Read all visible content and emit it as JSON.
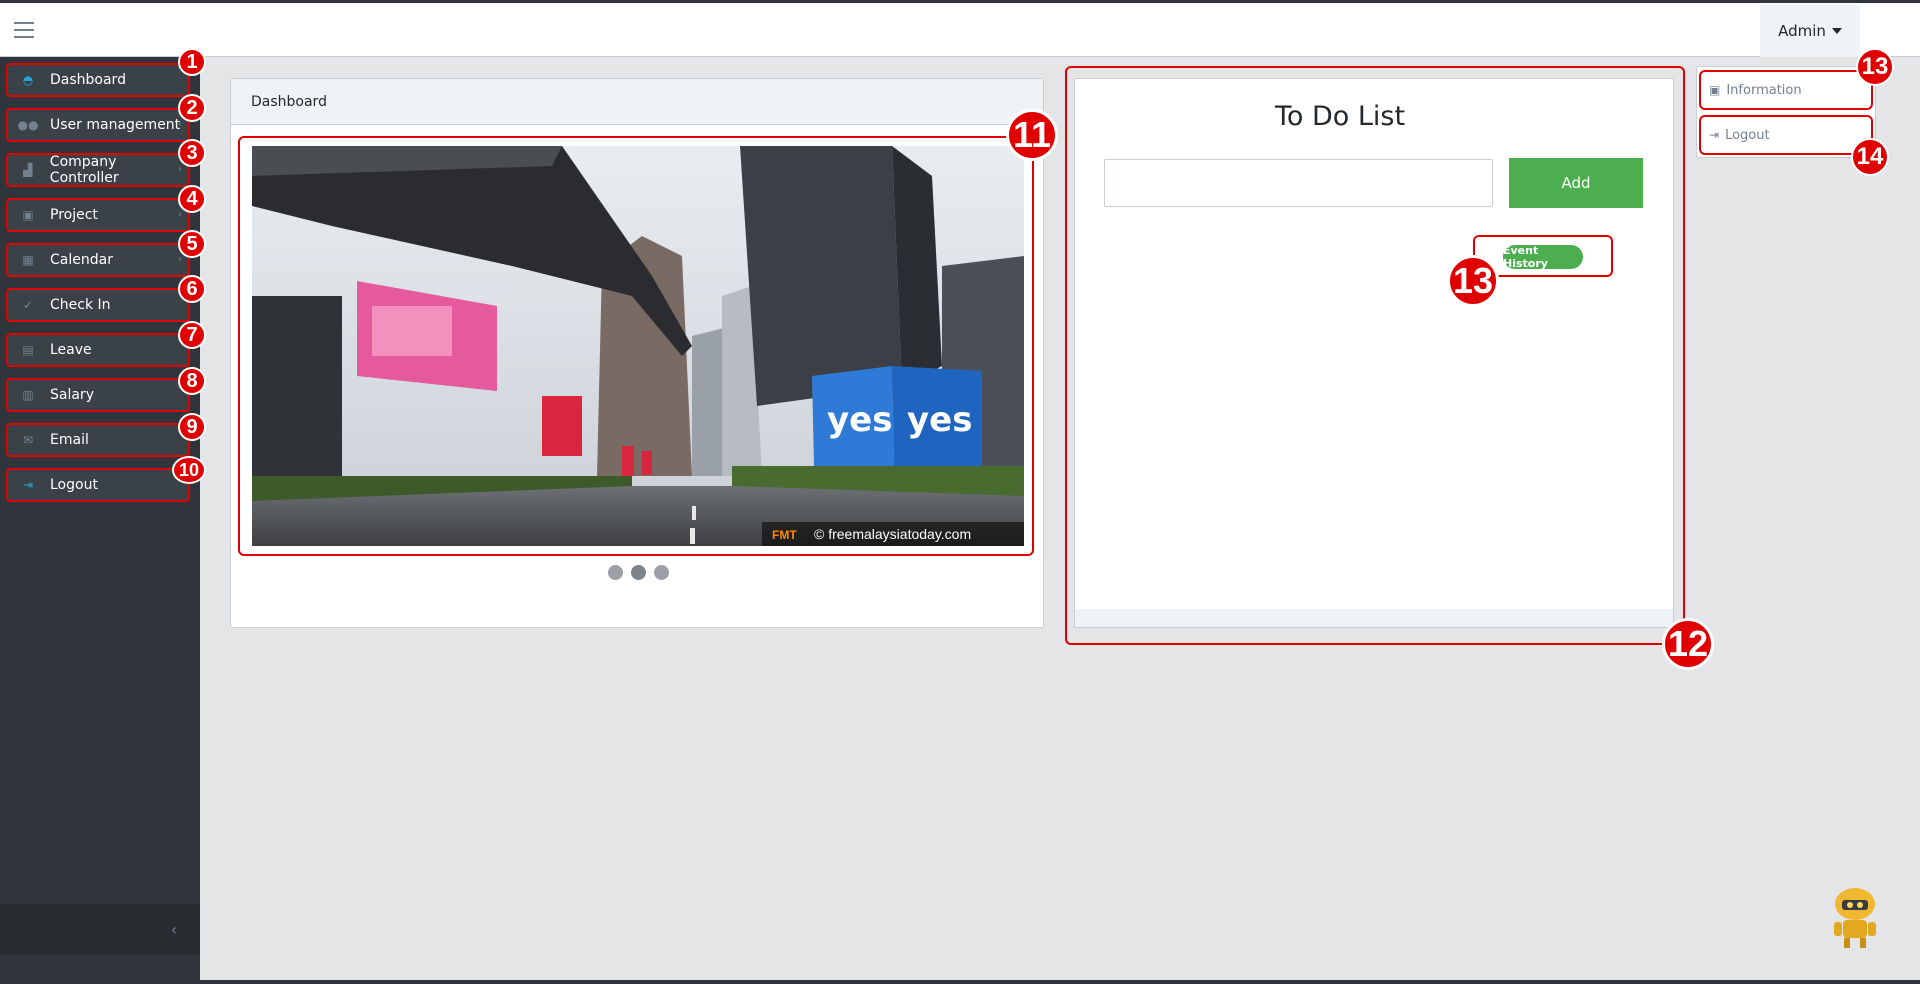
{
  "header": {
    "admin_label": "Admin"
  },
  "sidebar": {
    "items": [
      {
        "label": "Dashboard",
        "icon": "speedometer-icon",
        "badge": "1"
      },
      {
        "label": "User management",
        "icon": "users-icon",
        "badge": "2"
      },
      {
        "label": "Company Controller",
        "icon": "chart-icon",
        "badge": "3"
      },
      {
        "label": "Project",
        "icon": "project-icon",
        "badge": "4"
      },
      {
        "label": "Calendar",
        "icon": "calendar-icon",
        "badge": "5"
      },
      {
        "label": "Check In",
        "icon": "check-icon",
        "badge": "6"
      },
      {
        "label": "Leave",
        "icon": "leave-icon",
        "badge": "7"
      },
      {
        "label": "Salary",
        "icon": "salary-icon",
        "badge": "8"
      },
      {
        "label": "Email",
        "icon": "envelope-icon",
        "badge": "9"
      },
      {
        "label": "Logout",
        "icon": "logout-icon",
        "badge": "10"
      }
    ]
  },
  "dashboard": {
    "header": "Dashboard",
    "slider_badge": "11",
    "watermark": "© freemalaysiatoday.com",
    "watermark_logo": "FMT",
    "billboard_text": "yes",
    "slides_count": 3
  },
  "todo": {
    "title": "To Do List",
    "input_placeholder": "",
    "add_label": "Add",
    "event_history_label": "Event History",
    "frame_badge": "12",
    "event_badge": "13"
  },
  "dropdown": {
    "information_label": "Information",
    "logout_label": "Logout",
    "information_badge": "13",
    "logout_badge": "14"
  },
  "colors": {
    "sidebar_bg": "#2f353a",
    "accent_red": "#e00000",
    "add_green": "#4cae4f",
    "icon_blue": "#20a8d8"
  }
}
